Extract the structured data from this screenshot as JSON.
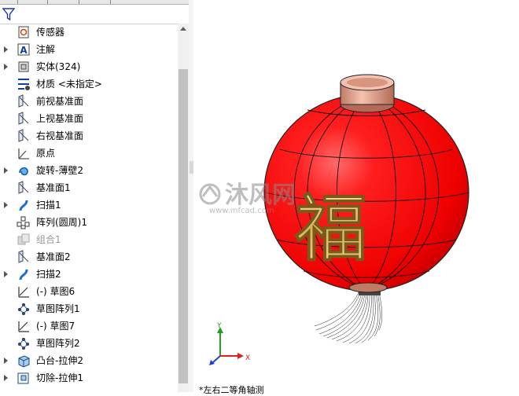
{
  "tree": {
    "items": [
      {
        "label": "传感器",
        "icon": "sensor-icon",
        "expandable": false,
        "dim": false
      },
      {
        "label": "注解",
        "icon": "annotation-icon",
        "expandable": true,
        "dim": false
      },
      {
        "label": "实体(324)",
        "icon": "solid-bodies-icon",
        "expandable": true,
        "dim": false
      },
      {
        "label": "材质 <未指定>",
        "icon": "material-icon",
        "expandable": false,
        "dim": false
      },
      {
        "label": "前视基准面",
        "icon": "plane-icon",
        "expandable": false,
        "dim": false
      },
      {
        "label": "上视基准面",
        "icon": "plane-icon",
        "expandable": false,
        "dim": false
      },
      {
        "label": "右视基准面",
        "icon": "plane-icon",
        "expandable": false,
        "dim": false
      },
      {
        "label": "原点",
        "icon": "origin-icon",
        "expandable": false,
        "dim": false
      },
      {
        "label": "旋转-薄壁2",
        "icon": "revolve-icon",
        "expandable": true,
        "dim": false
      },
      {
        "label": "基准面1",
        "icon": "plane-icon",
        "expandable": false,
        "dim": false
      },
      {
        "label": "扫描1",
        "icon": "sweep-icon",
        "expandable": true,
        "dim": false
      },
      {
        "label": "阵列(圆周)1",
        "icon": "circular-pattern-icon",
        "expandable": false,
        "dim": false
      },
      {
        "label": "组合1",
        "icon": "combine-icon",
        "expandable": false,
        "dim": true
      },
      {
        "label": "基准面2",
        "icon": "plane-icon",
        "expandable": false,
        "dim": false
      },
      {
        "label": "扫描2",
        "icon": "sweep-icon",
        "expandable": true,
        "dim": false
      },
      {
        "label": "(-) 草图6",
        "icon": "sketch-icon",
        "expandable": false,
        "dim": false
      },
      {
        "label": "草图阵列1",
        "icon": "sketch-pattern-icon",
        "expandable": false,
        "dim": false
      },
      {
        "label": "(-) 草图7",
        "icon": "sketch-icon",
        "expandable": false,
        "dim": false
      },
      {
        "label": "草图阵列2",
        "icon": "sketch-pattern-icon",
        "expandable": false,
        "dim": false
      },
      {
        "label": "凸台-拉伸2",
        "icon": "boss-extrude-icon",
        "expandable": true,
        "dim": false
      },
      {
        "label": "切除-拉伸1",
        "icon": "cut-extrude-icon",
        "expandable": true,
        "dim": false
      }
    ]
  },
  "viewport": {
    "lantern_char": "福",
    "watermark_text": "沐风网",
    "watermark_url": "www.mfcad.com",
    "axis_x": "X",
    "axis_y": "Y",
    "bottom_text": "*左右二等角轴测"
  },
  "colors": {
    "lantern_red": "#ff1a1a",
    "lantern_dark": "#c80000",
    "gold": "#e6c46a",
    "cap": "#e8a48a",
    "axis_x": "#e02020",
    "axis_y": "#20a020",
    "axis_z": "#2040d0"
  }
}
